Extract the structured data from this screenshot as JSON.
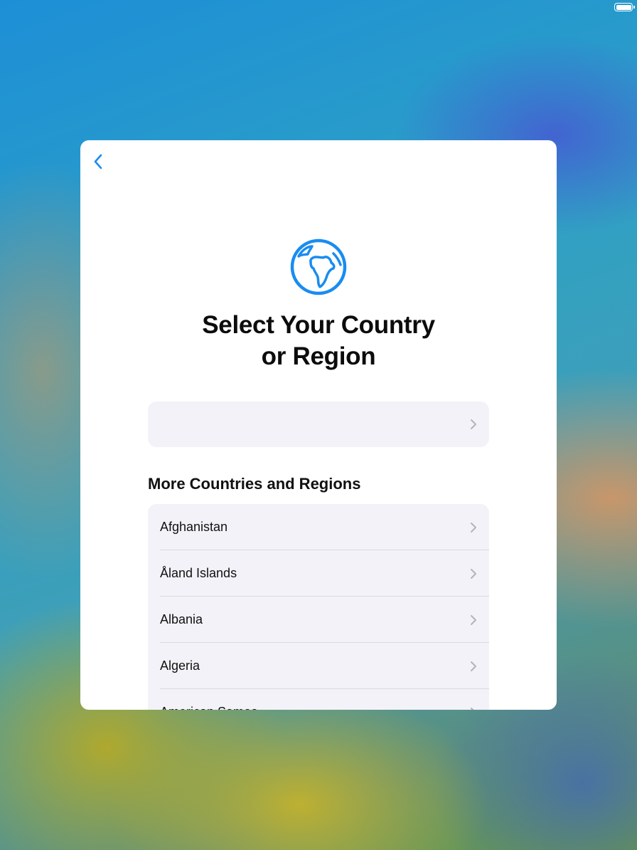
{
  "status_bar": {
    "battery_icon": "battery-full-icon"
  },
  "card": {
    "back_icon": "chevron-left-icon",
    "hero_icon": "globe-africa-icon",
    "title_line1": "Select Your Country",
    "title_line2": "or Region",
    "selected_value": "",
    "section_header": "More Countries and Regions",
    "countries": [
      {
        "label": "Afghanistan"
      },
      {
        "label": "Åland Islands"
      },
      {
        "label": "Albania"
      },
      {
        "label": "Algeria"
      },
      {
        "label": "American Samoa"
      }
    ]
  },
  "colors": {
    "accent": "#1a8cf0",
    "row_bg": "#f3f2f8",
    "chevron": "#b3b3b8"
  }
}
